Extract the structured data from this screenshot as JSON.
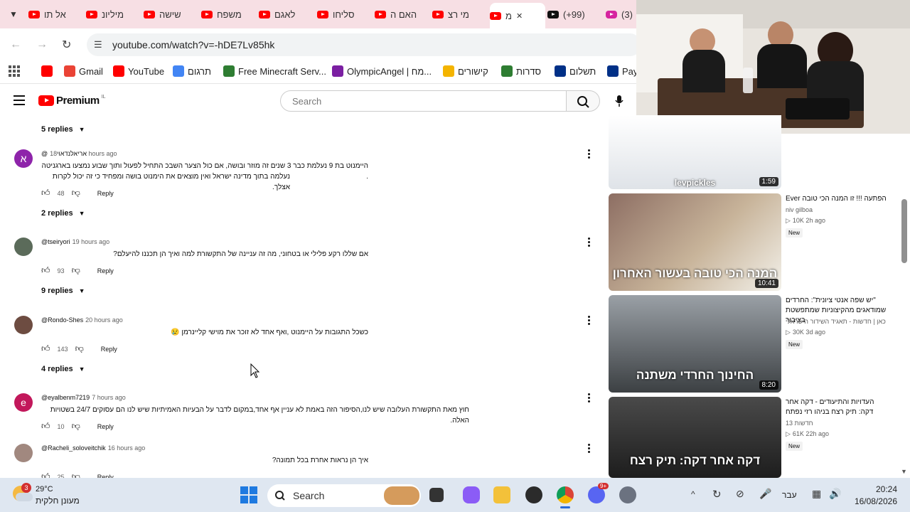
{
  "browser": {
    "tabs": [
      {
        "label": "אל תו",
        "active": false
      },
      {
        "label": "מיליונ",
        "active": false
      },
      {
        "label": "שישה",
        "active": false
      },
      {
        "label": "משפח",
        "active": false
      },
      {
        "label": "לאגם",
        "active": false
      },
      {
        "label": "סליחו",
        "active": false
      },
      {
        "label": "האם ה",
        "active": false
      },
      {
        "label": "מי רצ",
        "active": false
      },
      {
        "label": "מ",
        "active": true
      },
      {
        "label": "(99+)",
        "active": false
      },
      {
        "label": "(3)",
        "active": false
      }
    ],
    "url": "youtube.com/watch?v=-hDE7Lv85hk",
    "bookmarks": [
      {
        "label": "",
        "icon": "youtube-icon"
      },
      {
        "label": "Gmail",
        "icon": "gmail-icon"
      },
      {
        "label": "YouTube",
        "icon": "youtube-icon"
      },
      {
        "label": "תרגום",
        "icon": "translate-icon"
      },
      {
        "label": "Free Minecraft Serv...",
        "icon": "minecraft-icon"
      },
      {
        "label": "OlympicAngel | מח...",
        "icon": "avatar-icon"
      },
      {
        "label": "קישורים",
        "icon": "star-icon"
      },
      {
        "label": "סדרות",
        "icon": "tv-icon"
      },
      {
        "label": "תשלום",
        "icon": "paypal-icon"
      },
      {
        "label": "Payl",
        "icon": "paypal-icon"
      }
    ]
  },
  "youtube": {
    "logo_text": "Premium",
    "region": "IL",
    "search_placeholder": "Search"
  },
  "comments": [
    {
      "replies_label": "5 replies"
    },
    {
      "author": "@אריאל‏נדאוי",
      "time": "18 hours ago",
      "avatar_letter": "א",
      "avatar_color": "#8e24aa",
      "text_line1": "היימנוט בת 9 נעלמת כבר 3 שנים זה מוזר ובושה, אם כול הצער השבכ  התחיל לפעול ותוך שבוע נמצעו בארגניטה .",
      "text_line2": "נעלמה בתוך מדינה ישראל ואין מוצאים את הימנוט בושה ומפחיד כי זה יכול לקרות אצלך.",
      "likes": "48",
      "reply": "Reply",
      "replies_label": "2 replies"
    },
    {
      "author": "@tseiryori",
      "time": "19 hours ago",
      "avatar_letter": "",
      "avatar_color": "#5b6b5a",
      "text_line1": "אם שללו רקע פלילי או בטחוני, מה זה עניינה של התקשורת למה ואיך הן תכננו להיעלם?",
      "text_line2": "",
      "likes": "93",
      "reply": "Reply",
      "replies_label": "9 replies"
    },
    {
      "author": "@Rondo-Shes",
      "time": "20 hours ago",
      "avatar_letter": "",
      "avatar_color": "#6d4c41",
      "text_line1": "כשכל התגובות על היימנוט ,ואף אחד לא זוכר את מוישי קליינרמן 😢",
      "text_line2": "",
      "likes": "143",
      "reply": "Reply",
      "replies_label": "4 replies"
    },
    {
      "author": "@eyalbenm7219",
      "time": "7 hours ago",
      "avatar_letter": "e",
      "avatar_color": "#c2185b",
      "text_line1": "חוץ מאת התקשורת העלובה שיש לנו,הסיפור הזה באמת לא עניין אף אחד,במקום לדבר על הבעיות האמיתיות שיש לנו הם עסוקים 24/7 בשטויות האלה.",
      "text_line2": "",
      "likes": "10",
      "reply": "Reply",
      "replies_label": ""
    },
    {
      "author": "@Racheli_soloveitchik",
      "time": "16 hours ago",
      "avatar_letter": "",
      "avatar_color": "#a1887f",
      "text_line1": "איך הן נראות אחרת בכל תמונה?",
      "text_line2": "",
      "likes": "25",
      "reply": "Reply",
      "replies_label": ""
    }
  ],
  "videos": [
    {
      "title": "",
      "channel": "",
      "meta": "",
      "duration": "1:59",
      "badge": "",
      "thumb_text": "levpickles"
    },
    {
      "title": "הפתעה !!! זו המנה הכי טובה Ever",
      "channel": "niv gilboa",
      "meta": "10K  2h ago",
      "duration": "10:41",
      "badge": "New",
      "thumb_text": "המנה הכי טובה בעשור האחרון"
    },
    {
      "title": "\"יש שפה אנטי ציונית\": החרדים שמודאגים מהקיצוניות שמתפשטת בציבור",
      "channel": "כאן | חדשות - תאגיד השידור הישראלי",
      "meta": "30K  3d ago",
      "duration": "8:20",
      "badge": "New",
      "thumb_text": "החינוך החרדי משתנה"
    },
    {
      "title": "העדויות והתיעודים - דקה אחר דקה: תיק רצח בניהו רזי נפתח",
      "channel": "חדשות 13",
      "meta": "61K  22h ago",
      "duration": "",
      "badge": "New",
      "thumb_text": "דקה אחר דקה: תיק רצח"
    }
  ],
  "taskbar": {
    "weather_temp": "29°C",
    "weather_desc": "מעונן חלקית",
    "weather_badge": "3",
    "search_label": "Search",
    "language": "עבר",
    "time": "20:24",
    "date": "16/08/2026",
    "discord_badge": "9+"
  },
  "colors": {
    "tabbar_bg": "#f7dfe4",
    "youtube_red": "#ff0000",
    "taskbar_bg": "#dfe7f1"
  }
}
